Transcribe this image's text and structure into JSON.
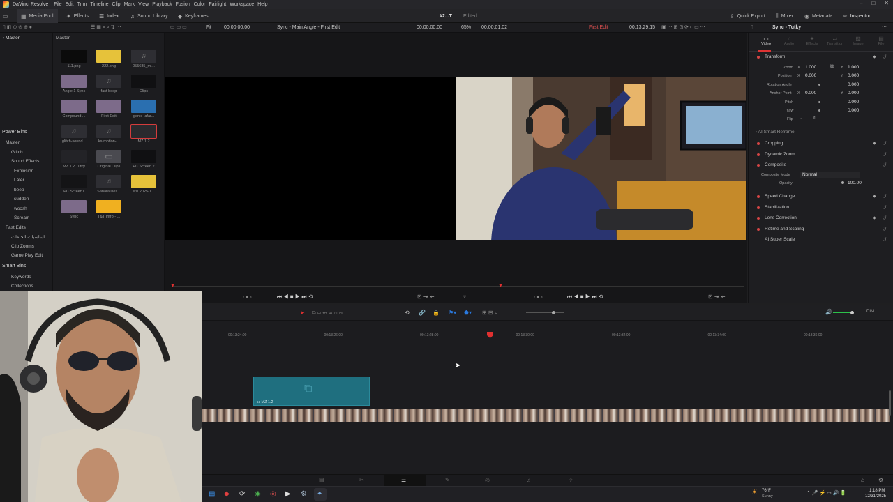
{
  "app": {
    "name": "DaVinci Resolve",
    "menu": [
      "File",
      "Edit",
      "Trim",
      "Timeline",
      "Clip",
      "Mark",
      "View",
      "Playback",
      "Fusion",
      "Color",
      "Fairlight",
      "Workspace",
      "Help"
    ],
    "project_title": "#2...T",
    "project_status": "Edited"
  },
  "toolbar": {
    "left": [
      "Media Pool",
      "Effects",
      "Index",
      "Sound Library",
      "Keyframes"
    ],
    "right": [
      "Quick Export",
      "Mixer",
      "Metadata",
      "Inspector"
    ]
  },
  "subbar": {
    "fit": "Fit",
    "src_tc": "00:00:00:00",
    "sync_label": "Sync - Main Angle - First Edit",
    "src_dur": "00:00:00:00",
    "zoom": "65%",
    "prg_tc": "00:00:01:02",
    "timeline_name": "First Edit",
    "prg_time": "00:13:29:15",
    "inspector_clip": "Sync - Tutky"
  },
  "bins": {
    "master": "Master",
    "power_bins_title": "Power Bins",
    "power_bins": [
      "Master",
      "Glitch",
      "Sound Effects",
      "Explosion",
      "Later",
      "beep",
      "sudden",
      "woosh",
      "Scream",
      "Fast Edits",
      "اساسيات الحلقات",
      "Clip Zooms",
      "Game Play Edit"
    ],
    "smart_bins_title": "Smart Bins",
    "smart_bins": [
      "Keywords",
      "Collections"
    ]
  },
  "pool": {
    "header": "Master",
    "items": [
      {
        "name": "111.png",
        "kind": "still"
      },
      {
        "name": "222.png",
        "kind": "still-yellow"
      },
      {
        "name": "055685_mi...",
        "kind": "audio"
      },
      {
        "name": "Angle 1 Sync",
        "kind": "multicam"
      },
      {
        "name": "fast beep",
        "kind": "audio"
      },
      {
        "name": "Clips",
        "kind": "timeline"
      },
      {
        "name": "Compound ...",
        "kind": "multicam"
      },
      {
        "name": "First Edit",
        "kind": "multicam"
      },
      {
        "name": "genie-jafar...",
        "kind": "blue"
      },
      {
        "name": "glitch-sound...",
        "kind": "audio"
      },
      {
        "name": "ks-motion-...",
        "kind": "audio"
      },
      {
        "name": "MZ 1.2",
        "kind": "selected"
      },
      {
        "name": "MZ 1.2 Tutky",
        "kind": "dark"
      },
      {
        "name": "Original Clips",
        "kind": "folder"
      },
      {
        "name": "PC Screen 2",
        "kind": "timeline"
      },
      {
        "name": "PC Screen1",
        "kind": "timeline-red"
      },
      {
        "name": "Sahara Des...",
        "kind": "audio"
      },
      {
        "name": "still 2025-1...",
        "kind": "still-yellow"
      },
      {
        "name": "Sync",
        "kind": "multicam"
      },
      {
        "name": "T&T Intro - ...",
        "kind": "orange"
      }
    ]
  },
  "inspector": {
    "tabs": [
      "Video",
      "Audio",
      "Effects",
      "Transition",
      "Image",
      "File"
    ],
    "transform": {
      "title": "Transform",
      "zoom_label": "Zoom",
      "zoom_x": "1.000",
      "zoom_y": "1.000",
      "position_label": "Position",
      "position_x": "0.000",
      "position_y": "0.000",
      "rotation_label": "Rotation Angle",
      "rotation": "0.000",
      "anchor_label": "Anchor Point",
      "anchor_x": "0.000",
      "anchor_y": "0.000",
      "pitch_label": "Pitch",
      "pitch": "0.000",
      "yaw_label": "Yaw",
      "yaw": "0.000",
      "flip_label": "Flip",
      "x": "X",
      "y": "Y"
    },
    "ai_reframe": "AI Smart Reframe",
    "sections": [
      "Cropping",
      "Dynamic Zoom",
      "Composite"
    ],
    "composite_mode_label": "Composite Mode",
    "composite_mode": "Normal",
    "opacity_label": "Opacity",
    "opacity": "100.00",
    "sections2": [
      "Speed Change",
      "Stabilization",
      "Lens Correction",
      "Retime and Scaling",
      "AI Super Scale"
    ]
  },
  "timeline": {
    "ruler": [
      "00:13:24:00",
      "00:13:26:00",
      "00:13:28:00",
      "00:13:30:00",
      "00:13:32:00",
      "00:13:34:00",
      "00:13:36:00"
    ],
    "clip_label": "MZ 1.2",
    "volume_label": "DIM"
  },
  "taskbar": {
    "weather": "76°F",
    "weather_desc": "Sunny",
    "time": "1:18 PM",
    "date": "12/31/2025"
  }
}
